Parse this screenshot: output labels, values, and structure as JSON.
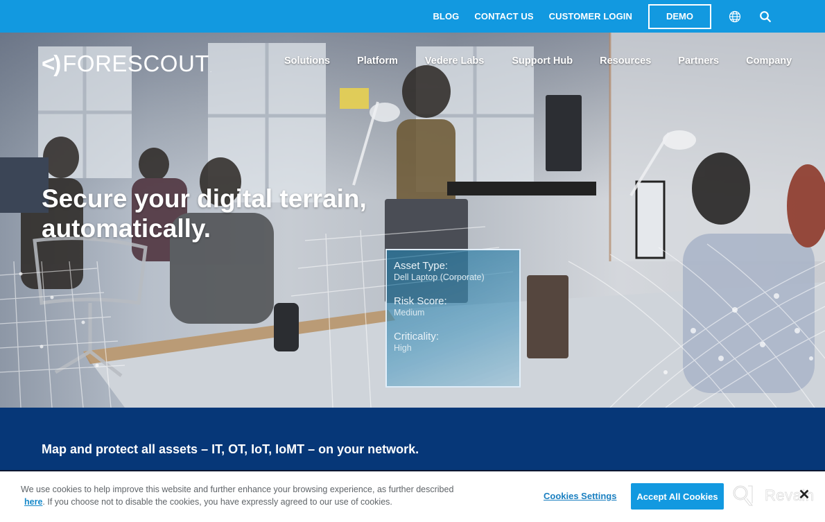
{
  "topbar": {
    "links": [
      "BLOG",
      "CONTACT US",
      "CUSTOMER LOGIN"
    ],
    "demo_label": "DEMO",
    "globe_icon": "globe-icon",
    "search_icon": "search-icon",
    "bg_color": "#1299e0"
  },
  "brand": {
    "mark": "<)",
    "name": "FORESCOUT",
    "tm": "."
  },
  "nav": {
    "items": [
      "Solutions",
      "Platform",
      "Vedere Labs",
      "Support Hub",
      "Resources",
      "Partners",
      "Company"
    ]
  },
  "hero": {
    "title_line1": "Secure your digital terrain,",
    "title_line2": "automatically.",
    "asset_card": {
      "fields": [
        {
          "label": "Asset Type:",
          "value": "Dell Laptop (Corporate)"
        },
        {
          "label": "Risk Score:",
          "value": "Medium"
        },
        {
          "label": "Criticality:",
          "value": "High"
        }
      ]
    }
  },
  "band": {
    "text": "Map and protect all assets – IT, OT, IoT, IoMT – on your network.",
    "bg_color": "#063778"
  },
  "cookie": {
    "text_before": "We use cookies to help improve this website and further enhance your browsing experience, as further described ",
    "link_label": "here",
    "text_after": ". If you choose not to disable the cookies, you have expressly agreed to our use of cookies.",
    "settings_label": "Cookies Settings",
    "accept_label": "Accept All Cookies",
    "close_label": "✕"
  },
  "watermark": {
    "text": "Revain"
  }
}
